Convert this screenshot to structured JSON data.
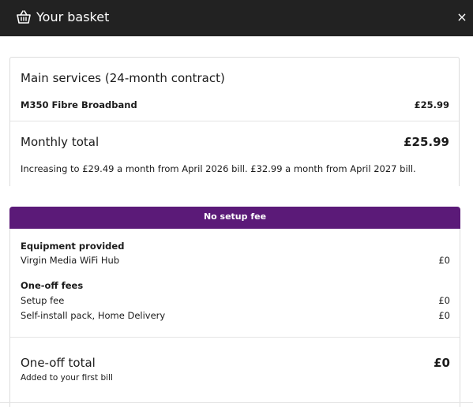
{
  "header": {
    "title": "Your basket",
    "close_label": "×",
    "icon": "basket-icon"
  },
  "main_services": {
    "heading": "Main services (24-month contract)",
    "item_name": "M350 Fibre Broadband",
    "item_price": "£25.99",
    "total_label": "Monthly total",
    "total_price": "£25.99",
    "note": "Increasing to £29.49 a month from April 2026 bill. £32.99 a month from April 2027 bill."
  },
  "banner": {
    "text": "No setup fee",
    "color": "#5b1a78"
  },
  "equipment": {
    "heading": "Equipment provided",
    "items": [
      {
        "label": "Virgin Media WiFi Hub",
        "price": "£0"
      }
    ]
  },
  "one_off_fees": {
    "heading": "One-off fees",
    "items": [
      {
        "label": "Setup fee",
        "price": "£0"
      },
      {
        "label": "Self-install pack, Home Delivery",
        "price": "£0"
      }
    ]
  },
  "one_off_total": {
    "label": "One-off total",
    "price": "£0",
    "note": "Added to your first bill"
  }
}
